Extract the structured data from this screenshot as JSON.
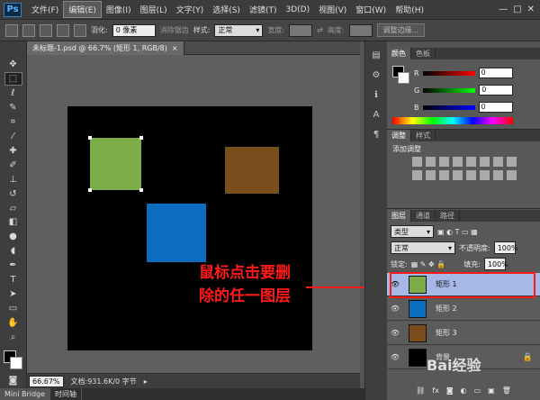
{
  "menu": {
    "logo": "Ps",
    "items": [
      "文件(F)",
      "编辑(E)",
      "图像(I)",
      "图层(L)",
      "文字(Y)",
      "选择(S)",
      "滤镜(T)",
      "3D(D)",
      "视图(V)",
      "窗口(W)",
      "帮助(H)"
    ],
    "active_index": 1
  },
  "window_controls": [
    "—",
    "□",
    "✕"
  ],
  "options": {
    "feather_label": "羽化:",
    "feather_value": "0 像素",
    "antialias_label": "消除锯齿",
    "style_label": "样式:",
    "style_value": "正常",
    "width_label": "宽度:",
    "height_label": "高度:",
    "refine_button": "调整边缘..."
  },
  "document": {
    "tab_title": "未标题-1.psd @ 66.7% (矩形 1, RGB/8)",
    "close": "×"
  },
  "canvas": {
    "background": "#000000",
    "rects": [
      {
        "color": "#7cad48"
      },
      {
        "color": "#7a4e1c"
      },
      {
        "color": "#0c6dc0"
      }
    ]
  },
  "annotation": {
    "line1": "鼠标点击要删",
    "line2": "除的任一图层"
  },
  "status": {
    "zoom": "66.67%",
    "doc_info": "文档:931.6K/0 字节"
  },
  "bottom_tabs": [
    "Mini Bridge",
    "时间轴"
  ],
  "color_panel": {
    "tabs": [
      "颜色",
      "色板"
    ],
    "channels": [
      {
        "label": "R",
        "value": "0"
      },
      {
        "label": "G",
        "value": "0"
      },
      {
        "label": "B",
        "value": "0"
      }
    ]
  },
  "adjust_panel": {
    "tabs": [
      "调整",
      "样式"
    ],
    "title": "添加调整"
  },
  "layers_panel": {
    "tabs": [
      "图层",
      "通道",
      "路径"
    ],
    "kind_filter": "类型",
    "blend_mode": "正常",
    "opacity_label": "不透明度:",
    "opacity_value": "100%",
    "lock_label": "锁定:",
    "fill_label": "填充:",
    "fill_value": "100%",
    "layers": [
      {
        "name": "矩形 1",
        "color": "#7cad48",
        "selected": true
      },
      {
        "name": "矩形 2",
        "color": "#0c6dc0",
        "selected": false
      },
      {
        "name": "矩形 3",
        "color": "#7a4e1c",
        "selected": false
      },
      {
        "name": "背景",
        "color": "#000000",
        "selected": false
      }
    ]
  },
  "watermark": "Bai经验"
}
